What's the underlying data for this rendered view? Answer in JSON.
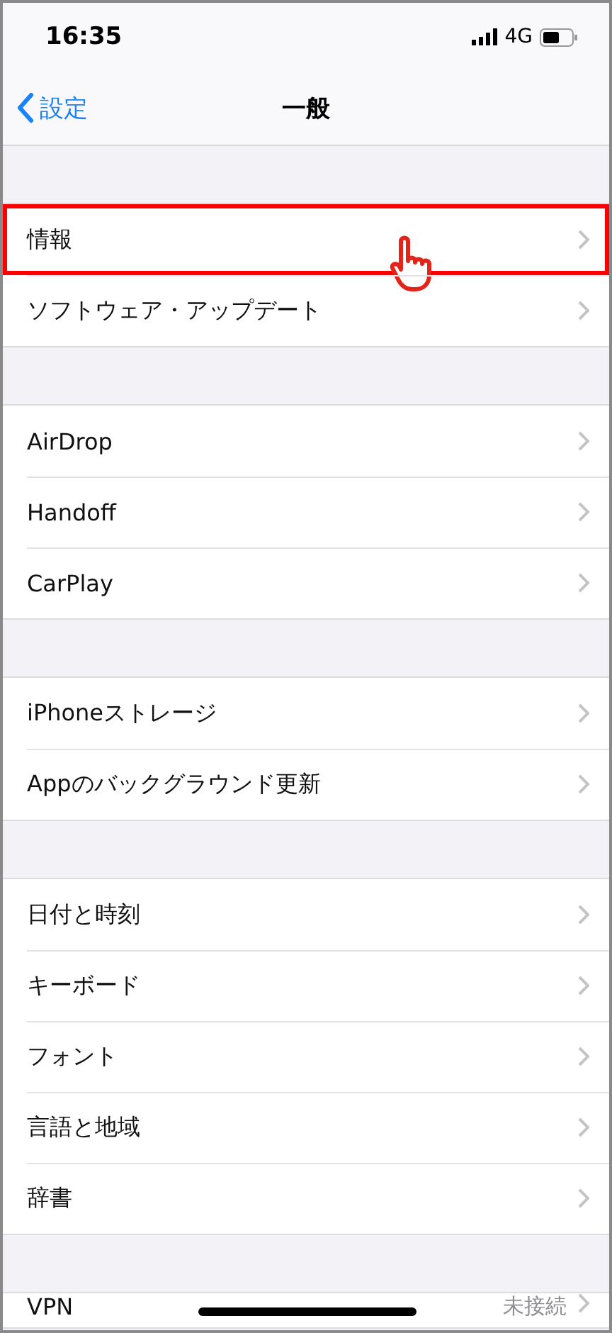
{
  "status_bar": {
    "time": "16:35",
    "network": "4G"
  },
  "nav": {
    "back": "設定",
    "title": "一般"
  },
  "groups": [
    {
      "items": [
        {
          "label": "情報",
          "highlighted": true,
          "pointer": true
        },
        {
          "label": "ソフトウェア・アップデート",
          "highlighted": false,
          "pointer": false
        }
      ]
    },
    {
      "items": [
        {
          "label": "AirDrop",
          "highlighted": false,
          "pointer": false
        },
        {
          "label": "Handoff",
          "highlighted": false,
          "pointer": false
        },
        {
          "label": "CarPlay",
          "highlighted": false,
          "pointer": false
        }
      ]
    },
    {
      "items": [
        {
          "label": "iPhoneストレージ",
          "highlighted": false,
          "pointer": false
        },
        {
          "label": "Appのバックグラウンド更新",
          "highlighted": false,
          "pointer": false
        }
      ]
    },
    {
      "items": [
        {
          "label": "日付と時刻",
          "highlighted": false,
          "pointer": false
        },
        {
          "label": "キーボード",
          "highlighted": false,
          "pointer": false
        },
        {
          "label": "フォント",
          "highlighted": false,
          "pointer": false
        },
        {
          "label": "言語と地域",
          "highlighted": false,
          "pointer": false
        },
        {
          "label": "辞書",
          "highlighted": false,
          "pointer": false
        }
      ]
    },
    {
      "items": [
        {
          "label": "VPN",
          "value": "未接続",
          "highlighted": false,
          "pointer": false
        }
      ]
    }
  ]
}
